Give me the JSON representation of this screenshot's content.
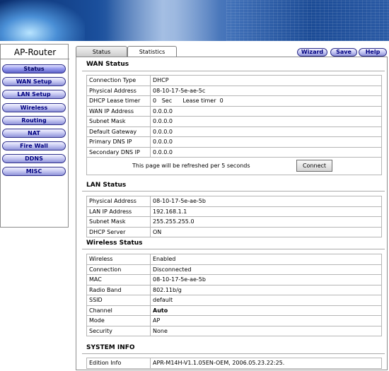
{
  "header": {
    "brand": "AP-Router"
  },
  "sidebar": {
    "items": [
      {
        "label": "Status"
      },
      {
        "label": "WAN Setup"
      },
      {
        "label": "LAN Setup"
      },
      {
        "label": "Wireless"
      },
      {
        "label": "Routing"
      },
      {
        "label": "NAT"
      },
      {
        "label": "Fire Wall"
      },
      {
        "label": "DDNS"
      },
      {
        "label": "MISC"
      }
    ]
  },
  "tabs": {
    "status": "Status",
    "statistics": "Statistics"
  },
  "toolbar": {
    "wizard": "Wizard",
    "save": "Save",
    "help": "Help"
  },
  "wan": {
    "title": "WAN Status",
    "rows": [
      {
        "k": "Connection Type",
        "v": "DHCP"
      },
      {
        "k": "Physical Address",
        "v": "08-10-17-5e-ae-5c"
      },
      {
        "k": "DHCP Lease timer",
        "v": "0   Sec      Lease timer  0"
      },
      {
        "k": "WAN IP Address",
        "v": "0.0.0.0"
      },
      {
        "k": "Subnet Mask",
        "v": "0.0.0.0"
      },
      {
        "k": "Default Gateway",
        "v": "0.0.0.0"
      },
      {
        "k": "Primary DNS IP",
        "v": "0.0.0.0"
      },
      {
        "k": "Secondary DNS IP",
        "v": "0.0.0.0"
      }
    ],
    "refresh_msg": "This page will be refreshed per 5 seconds",
    "connect_label": "Connect"
  },
  "lan": {
    "title": "LAN Status",
    "rows": [
      {
        "k": "Physical Address",
        "v": "08-10-17-5e-ae-5b"
      },
      {
        "k": "LAN IP Address",
        "v": "192.168.1.1"
      },
      {
        "k": "Subnet Mask",
        "v": "255.255.255.0"
      },
      {
        "k": "DHCP Server",
        "v": "ON"
      }
    ]
  },
  "wireless": {
    "title": "Wireless Status",
    "rows": [
      {
        "k": "Wireless",
        "v": "Enabled"
      },
      {
        "k": "Connection",
        "v": "Disconnected"
      },
      {
        "k": "MAC",
        "v": "08-10-17-5e-ae-5b"
      },
      {
        "k": "Radio Band",
        "v": "802.11b/g"
      },
      {
        "k": "SSID",
        "v": "default"
      },
      {
        "k": "Channel",
        "v": "Auto"
      },
      {
        "k": "Mode",
        "v": "AP"
      },
      {
        "k": "Security",
        "v": "None"
      }
    ]
  },
  "system": {
    "title": "SYSTEM INFO",
    "rows": [
      {
        "k": "Edition Info",
        "v": "APR-M14H-V1.1.05EN-OEM, 2006.05.23.22:25."
      }
    ]
  }
}
